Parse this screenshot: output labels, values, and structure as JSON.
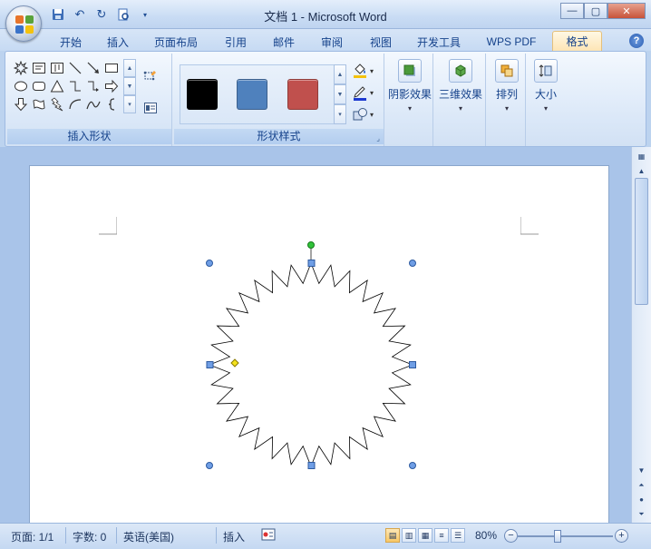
{
  "window": {
    "title": "文档 1 - Microsoft Word",
    "minimize": "—",
    "maximize": "▢",
    "close": "✕"
  },
  "quick_access": {
    "save": "save-icon",
    "undo": "undo-icon",
    "redo": "redo-icon",
    "print_preview": "print-preview-icon"
  },
  "tabs": [
    {
      "label": "开始"
    },
    {
      "label": "插入"
    },
    {
      "label": "页面布局"
    },
    {
      "label": "引用"
    },
    {
      "label": "邮件"
    },
    {
      "label": "审阅"
    },
    {
      "label": "视图"
    },
    {
      "label": "开发工具"
    },
    {
      "label": "WPS PDF"
    },
    {
      "label": "格式",
      "active": true
    }
  ],
  "help": "?",
  "ribbon": {
    "insert_shapes": {
      "label": "插入形状"
    },
    "shape_styles": {
      "label": "形状样式",
      "swatches": [
        {
          "color": "#000000"
        },
        {
          "color": "#4f81bd"
        },
        {
          "color": "#c0504d"
        }
      ]
    },
    "shadow_effects": {
      "label": "阴影效果"
    },
    "three_d_effects": {
      "label": "三维效果"
    },
    "arrange": {
      "label": "排列"
    },
    "size": {
      "label": "大小"
    }
  },
  "status": {
    "page": "页面: 1/1",
    "words": "字数: 0",
    "language": "英语(美国)",
    "mode": "插入",
    "zoom": "80%"
  },
  "accent": "#fde5b5"
}
